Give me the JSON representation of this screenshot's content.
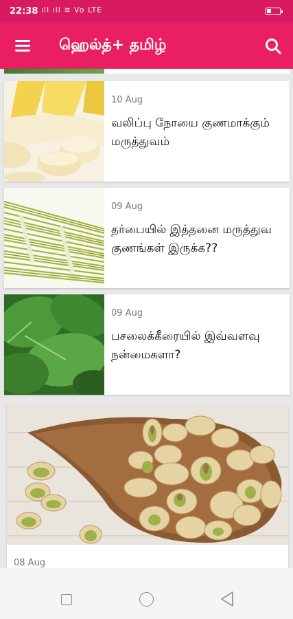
{
  "status_bar": {
    "time": "22:38",
    "signal_text": "ıll ıll ≋ Vo LTE"
  },
  "app_bar": {
    "title": "ஹெல்த்+ தமிழ்"
  },
  "articles": [
    {
      "date": "10 Aug",
      "title": "வலிப்பு நோயை குணமாக்கும் மருத்துவம்",
      "image": "banana"
    },
    {
      "date": "09 Aug",
      "title": "தர்பையில் இத்தனை மருத்துவ குணங்கள் இருக்க??",
      "image": "darbha-grass"
    },
    {
      "date": "09 Aug",
      "title": "பசலைக்கீரையில் இவ்வளவு நன்மைகளா?",
      "image": "spinach"
    },
    {
      "date": "08 Aug",
      "image": "pistachios"
    }
  ],
  "icons": {
    "menu": "hamburger-icon",
    "search": "search-icon",
    "nav_recent": "square-icon",
    "nav_home": "circle-icon",
    "nav_back": "triangle-back-icon"
  },
  "colors": {
    "status_bar": "#d81b60",
    "app_bar": "#e91e63"
  }
}
